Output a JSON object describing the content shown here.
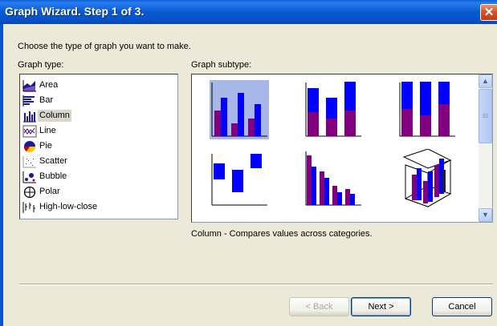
{
  "window": {
    "title": "Graph Wizard. Step 1 of 3."
  },
  "instruction": "Choose the type of graph you want to make.",
  "graph_type": {
    "label": "Graph type:",
    "items": [
      {
        "label": "Area",
        "icon": "area-chart-icon"
      },
      {
        "label": "Bar",
        "icon": "bar-chart-icon"
      },
      {
        "label": "Column",
        "icon": "column-chart-icon",
        "selected": true
      },
      {
        "label": "Line",
        "icon": "line-chart-icon"
      },
      {
        "label": "Pie",
        "icon": "pie-chart-icon"
      },
      {
        "label": "Scatter",
        "icon": "scatter-chart-icon"
      },
      {
        "label": "Bubble",
        "icon": "bubble-chart-icon"
      },
      {
        "label": "Polar",
        "icon": "polar-chart-icon"
      },
      {
        "label": "High-low-close",
        "icon": "high-low-close-icon"
      }
    ]
  },
  "graph_subtype": {
    "label": "Graph subtype:",
    "items": [
      {
        "name": "clustered-column",
        "selected": true
      },
      {
        "name": "stacked-column"
      },
      {
        "name": "100-percent-stacked-column"
      },
      {
        "name": "floating-column"
      },
      {
        "name": "clustered-column-offset"
      },
      {
        "name": "3d-column"
      }
    ]
  },
  "description": "Column - Compares values across categories.",
  "buttons": {
    "back": "< Back",
    "next": "Next >",
    "cancel": "Cancel"
  },
  "colors": {
    "series_blue": "#0000ff",
    "series_purple": "#800080",
    "selection": "#a7b8e8",
    "titlebar": "#0759d0"
  }
}
